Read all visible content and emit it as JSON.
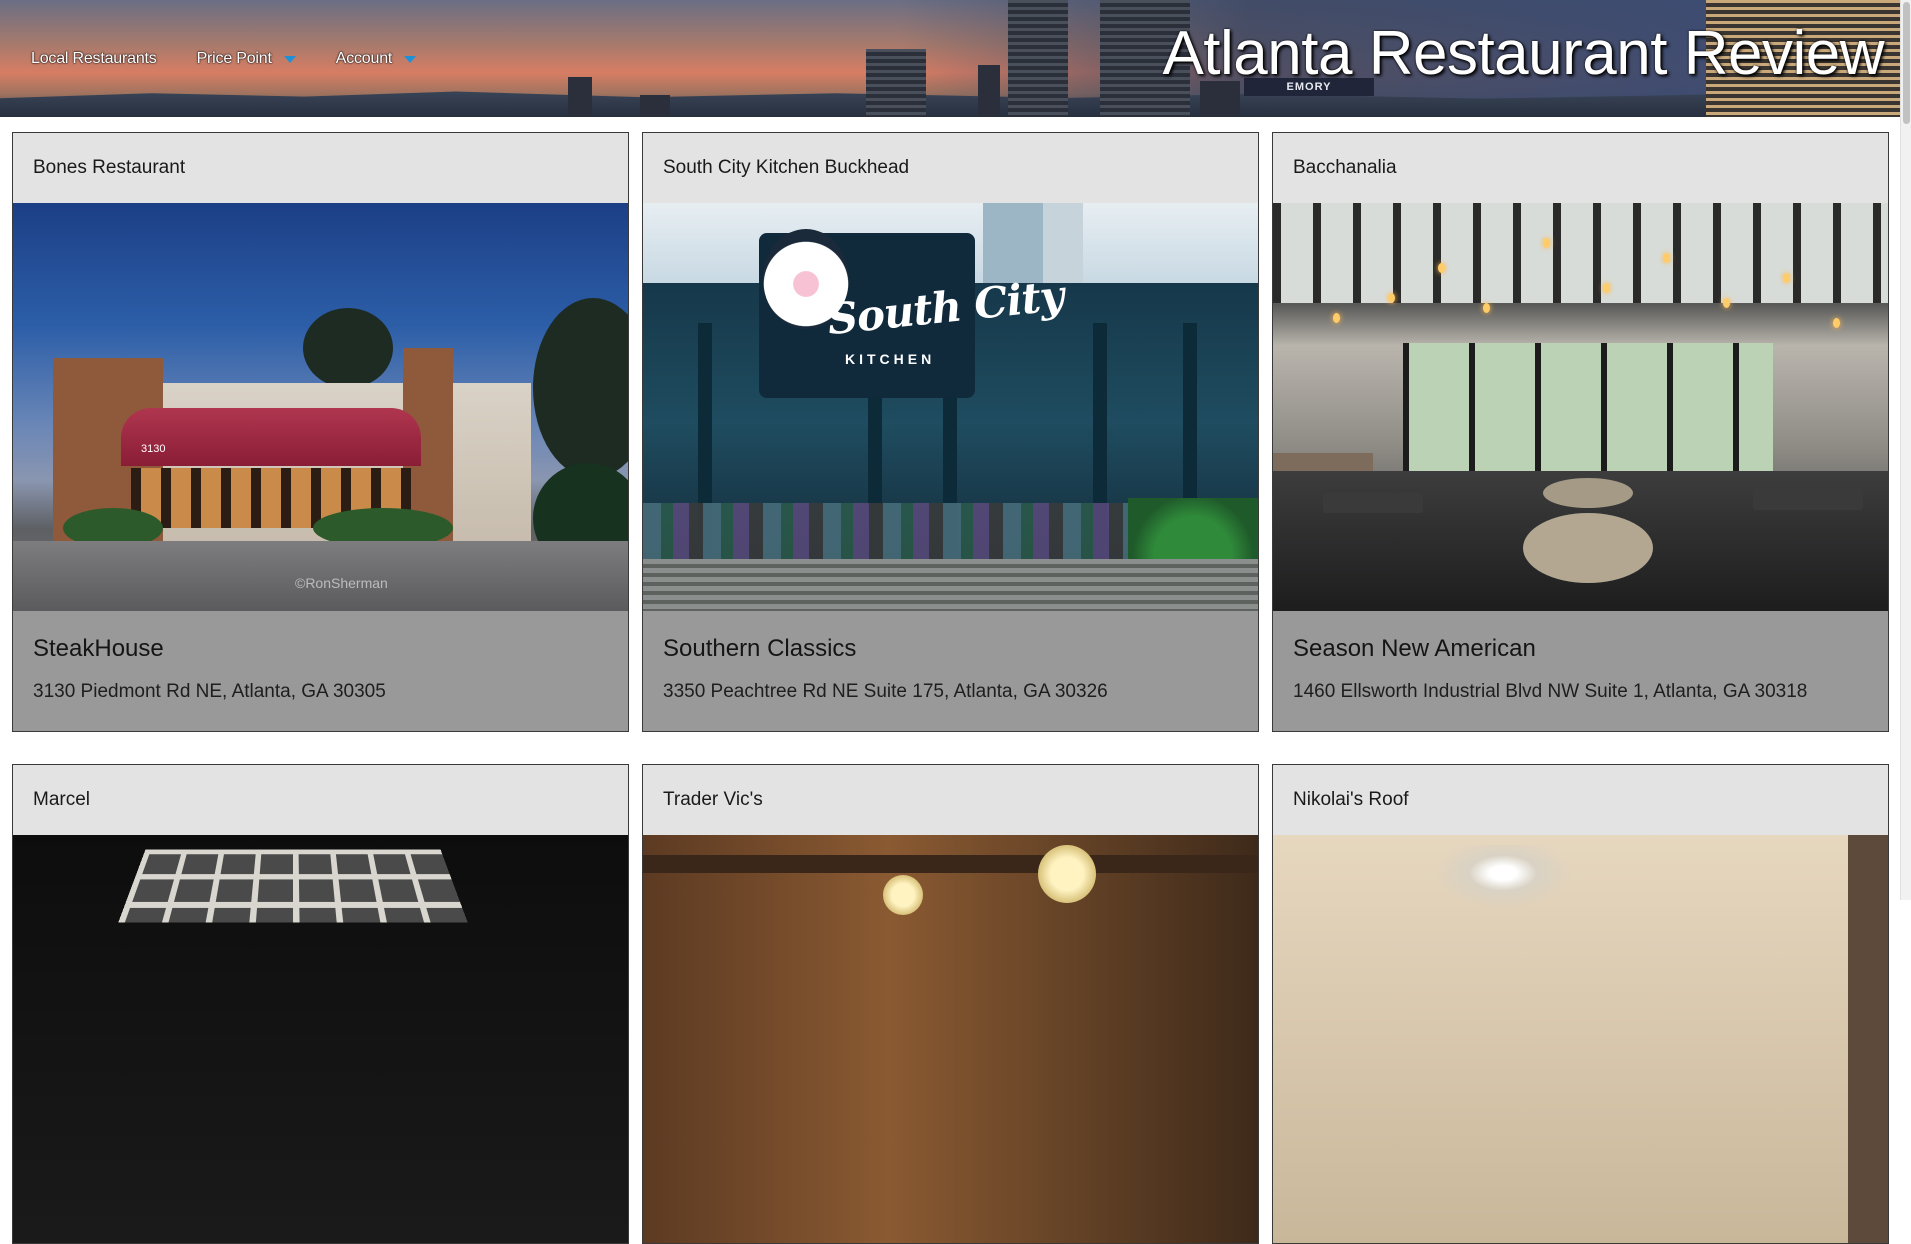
{
  "header": {
    "site_title": "Atlanta Restaurant Review",
    "nav": [
      {
        "label": "Local Restaurants",
        "has_dropdown": false
      },
      {
        "label": "Price Point",
        "has_dropdown": true
      },
      {
        "label": "Account",
        "has_dropdown": true
      }
    ],
    "dropdown_caret_color": "#1e90d8",
    "billboard_text": "EMORY"
  },
  "restaurants": [
    {
      "name": "Bones Restaurant",
      "cuisine": "SteakHouse",
      "address": "3130 Piedmont Rd NE, Atlanta, GA 30305",
      "image_caption": "©RonSherman",
      "building_number": "3130"
    },
    {
      "name": "South City Kitchen Buckhead",
      "cuisine": "Southern Classics",
      "address": "3350 Peachtree Rd NE Suite 175, Atlanta, GA 30326",
      "sign_text": "South City",
      "sign_subtext": "KITCHEN"
    },
    {
      "name": "Bacchanalia",
      "cuisine": "Season New American",
      "address": "1460 Ellsworth Industrial Blvd NW Suite 1, Atlanta, GA 30318"
    },
    {
      "name": "Marcel"
    },
    {
      "name": "Trader Vic's"
    },
    {
      "name": "Nikolai's Roof"
    }
  ],
  "colors": {
    "card_header_bg": "#e3e3e3",
    "card_footer_bg": "#999999",
    "page_bg": "#ffffff"
  }
}
